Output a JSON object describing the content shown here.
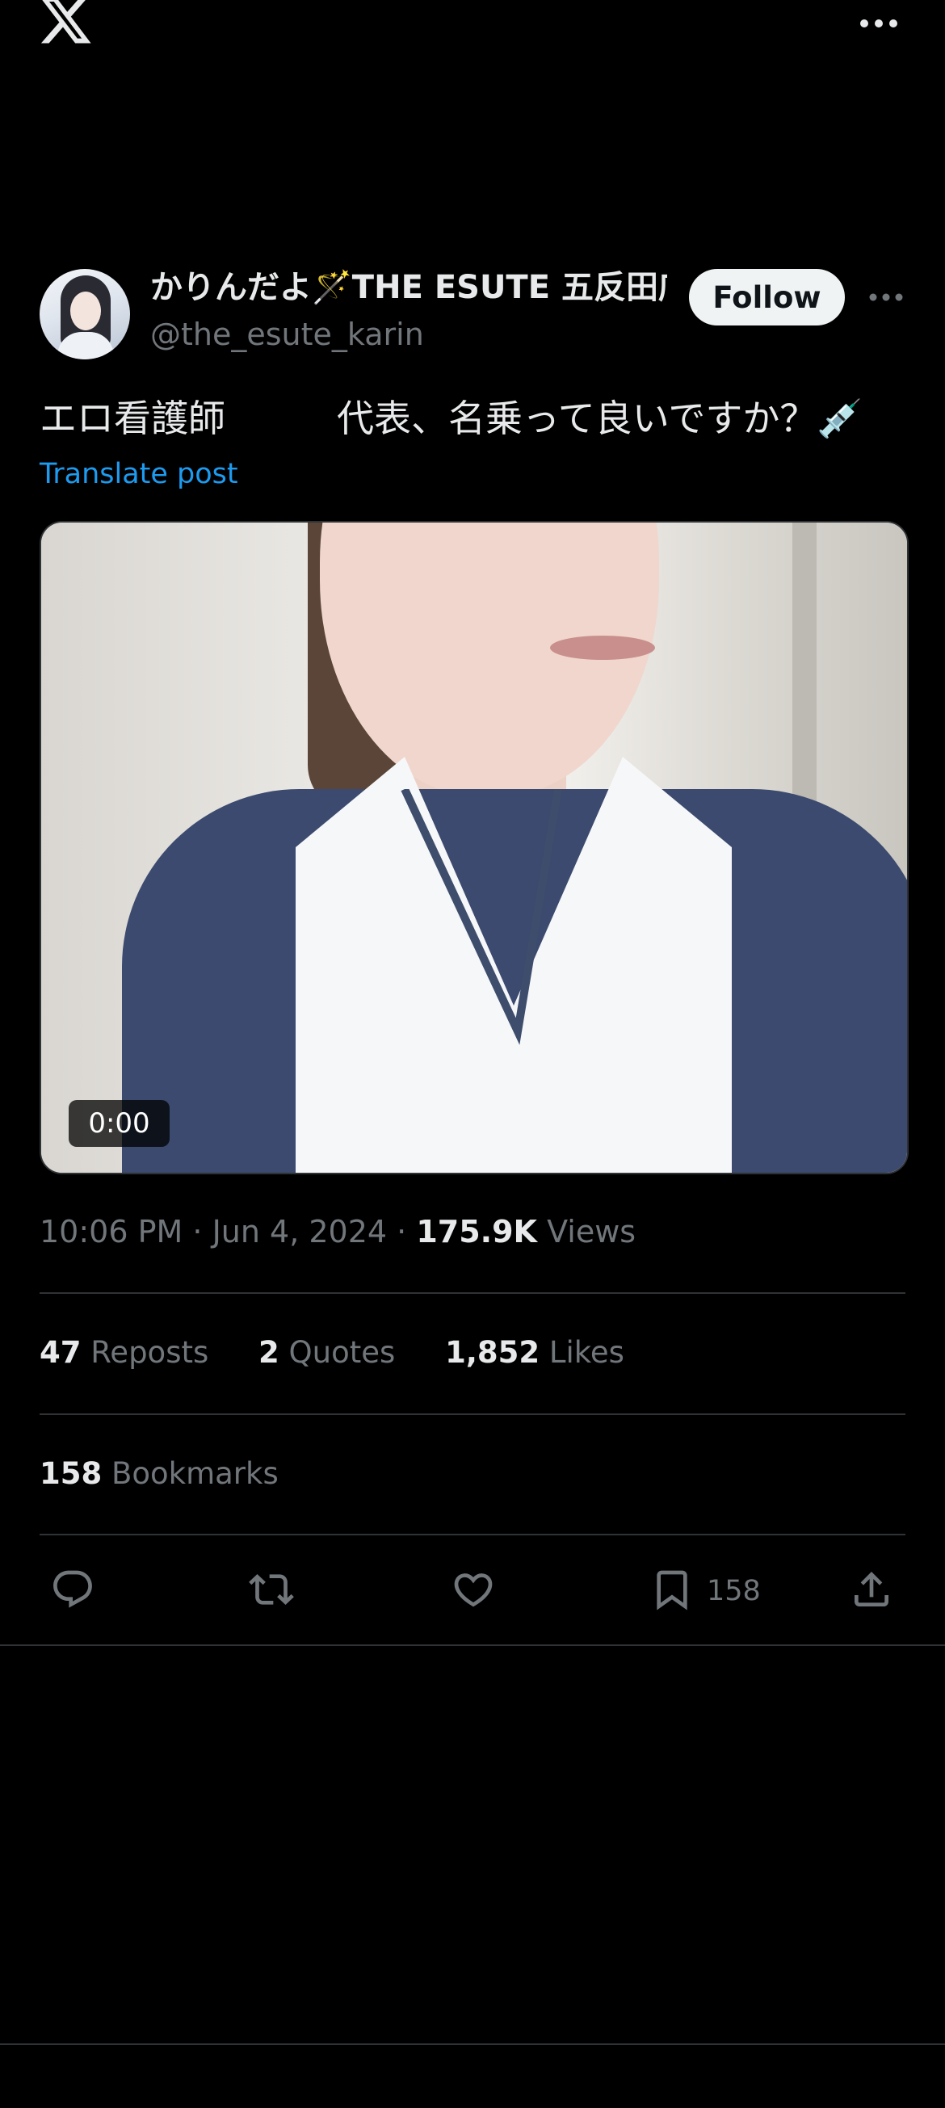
{
  "app": {
    "logo": "x-logo-icon",
    "more": "more-horizontal-icon"
  },
  "author": {
    "display_name": "かりんだよ🪄THE ESUTE 五反田店",
    "handle": "@the_esute_karin",
    "follow_label": "Follow"
  },
  "post": {
    "text": "エロ看護師　　　代表、名乗って良いですか？💉",
    "translate_label": "Translate post",
    "media": {
      "duration": "0:00"
    },
    "time": "10:06 PM",
    "date": "Jun 4, 2024",
    "sep": "·",
    "views_count": "175.9K",
    "views_label": "Views"
  },
  "stats": {
    "reposts_count": "47",
    "reposts_label": "Reposts",
    "quotes_count": "2",
    "quotes_label": "Quotes",
    "likes_count": "1,852",
    "likes_label": "Likes",
    "bookmarks_count": "158",
    "bookmarks_label": "Bookmarks"
  },
  "actions": {
    "reply": "reply-icon",
    "repost": "repost-icon",
    "like": "like-icon",
    "bookmark": "bookmark-icon",
    "bookmark_count": "158",
    "share": "share-icon"
  },
  "colors": {
    "background": "#000000",
    "accent": "#1d9bf0",
    "muted": "#71767b",
    "text": "#e7e9ea"
  }
}
